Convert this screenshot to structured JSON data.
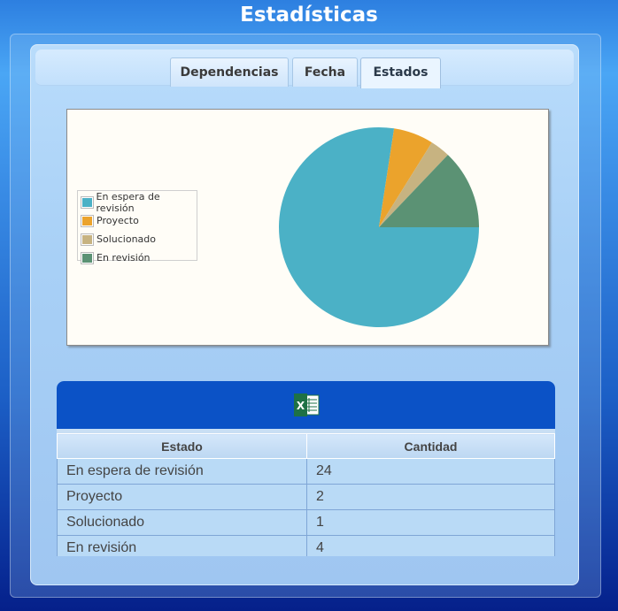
{
  "page": {
    "title": "Estadísticas"
  },
  "tabs": [
    {
      "label": "Dependencias",
      "active": false
    },
    {
      "label": "Fecha",
      "active": false
    },
    {
      "label": "Estados",
      "active": true
    }
  ],
  "colors": {
    "en_espera": "#4bb1c6",
    "proyecto": "#eba32c",
    "solucionado": "#c7b381",
    "en_revision": "#5b9274",
    "header_blue": "#0b52c6"
  },
  "export": {
    "icon": "excel-icon",
    "label": "X"
  },
  "chart_data": {
    "type": "pie",
    "title": "",
    "legend_position": "left",
    "categories": [
      "En espera de revisión",
      "Proyecto",
      "Solucionado",
      "En revisión"
    ],
    "values": [
      24,
      2,
      1,
      4
    ],
    "colors": [
      "#4bb1c6",
      "#eba32c",
      "#c7b381",
      "#5b9274"
    ]
  },
  "table": {
    "headers": [
      "Estado",
      "Cantidad"
    ],
    "rows": [
      [
        "En espera de revisión",
        "24"
      ],
      [
        "Proyecto",
        "2"
      ],
      [
        "Solucionado",
        "1"
      ],
      [
        "En revisión",
        "4"
      ]
    ]
  }
}
